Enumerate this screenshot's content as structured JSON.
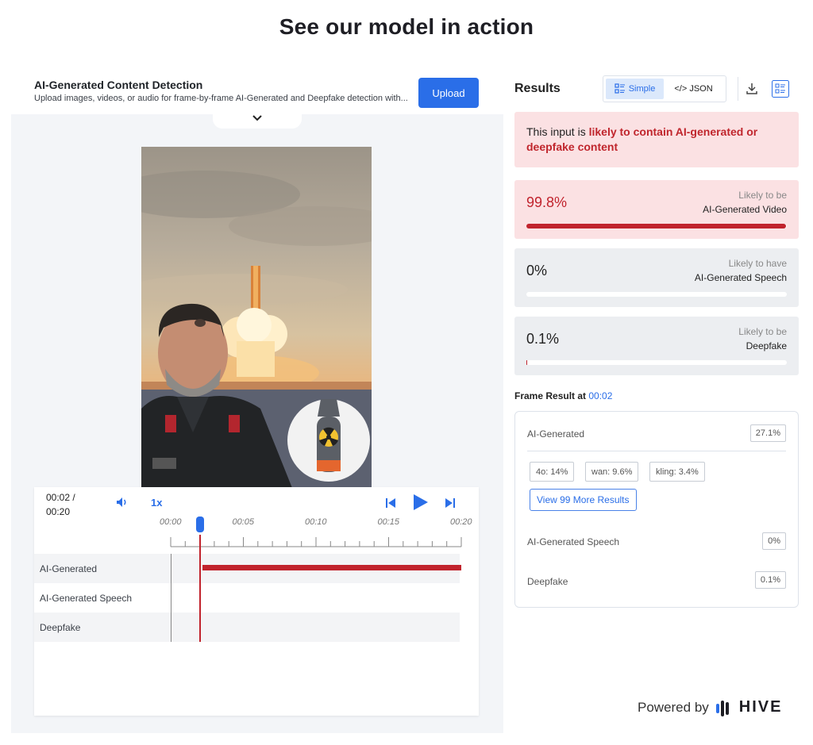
{
  "page": {
    "title": "See our model in action"
  },
  "detector": {
    "title": "AI-Generated Content Detection",
    "subtitle": "Upload images, videos, or audio for frame-by-frame AI-Generated and Deepfake detection with...",
    "upload_label": "Upload"
  },
  "player": {
    "time_current": "00:02 /",
    "time_total": "00:20",
    "speed": "1x",
    "ticks": [
      "00:00",
      "00:05",
      "00:10",
      "00:15",
      "00:20"
    ],
    "tracks": [
      "AI-Generated",
      "AI-Generated Speech",
      "Deepfake"
    ],
    "playhead_fraction": 0.1,
    "ai_generated_segment_start_fraction": 0.1
  },
  "results": {
    "title": "Results",
    "toggle_simple": "Simple",
    "toggle_json": "</> JSON",
    "alert_prefix": "This input is ",
    "alert_highlight": "likely to contain AI-generated or deepfake content",
    "scores": [
      {
        "pct": "99.8%",
        "line1": "Likely to be",
        "line2": "AI-Generated Video",
        "fill": 0.998,
        "accent": "#c1232d",
        "bg": "#fbe1e3"
      },
      {
        "pct": "0%",
        "line1": "Likely to have",
        "line2": "AI-Generated Speech",
        "fill": 0,
        "accent": "#c1232d",
        "bg": "#eceef1"
      },
      {
        "pct": "0.1%",
        "line1": "Likely to be",
        "line2": "Deepfake",
        "fill": 0.001,
        "accent": "#c1232d",
        "bg": "#eceef1"
      }
    ],
    "frame_label": "Frame Result at",
    "frame_time": "00:02",
    "frame": {
      "ai_generated_label": "AI-Generated",
      "ai_generated_value": "27.1%",
      "chips": [
        "4o: 14%",
        "wan: 9.6%",
        "kling: 3.4%"
      ],
      "more_label": "View 99 More Results",
      "speech_label": "AI-Generated Speech",
      "speech_value": "0%",
      "deepfake_label": "Deepfake",
      "deepfake_value": "0.1%"
    }
  },
  "footer": {
    "powered_by": "Powered by",
    "brand": "HIVE"
  }
}
